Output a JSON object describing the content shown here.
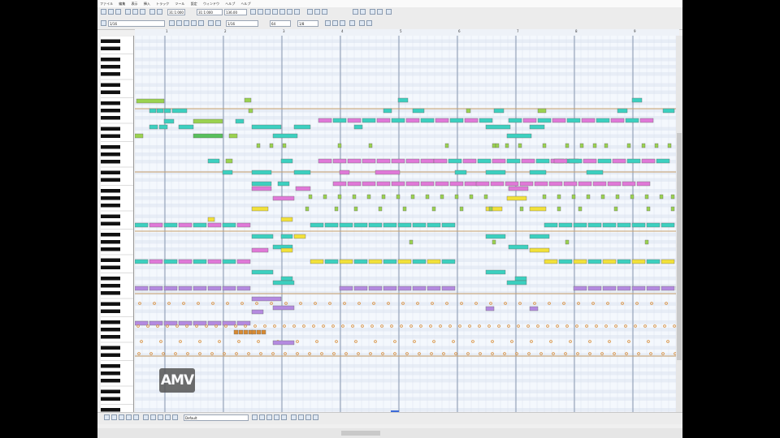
{
  "menu": [
    "ファイル",
    "編集",
    "表示",
    "挿入",
    "トラック",
    "ツール",
    "設定",
    "ウィンドウ",
    "ヘルプ",
    "ヘルプ"
  ],
  "toolbar": {
    "measure_field": "31:1:000",
    "tempo_field": "136.00",
    "snap_field": "1/16",
    "velocity_field": "64",
    "length_field": "1/8",
    "mode_field": "オフ"
  },
  "bottom_toolbar": {
    "tool_field": "Default"
  },
  "logo_text": "AMV",
  "ruler": {
    "labels": [
      "1",
      "2",
      "3",
      "4",
      "5",
      "6",
      "7",
      "8",
      "9"
    ]
  },
  "colors": {
    "teal": "#3cd0c0",
    "pink": "#e079d8",
    "purple": "#b48ae0",
    "green": "#9ad24f",
    "lime": "#58c05c",
    "yellow": "#f2e13a",
    "orange": "#d88a32"
  }
}
